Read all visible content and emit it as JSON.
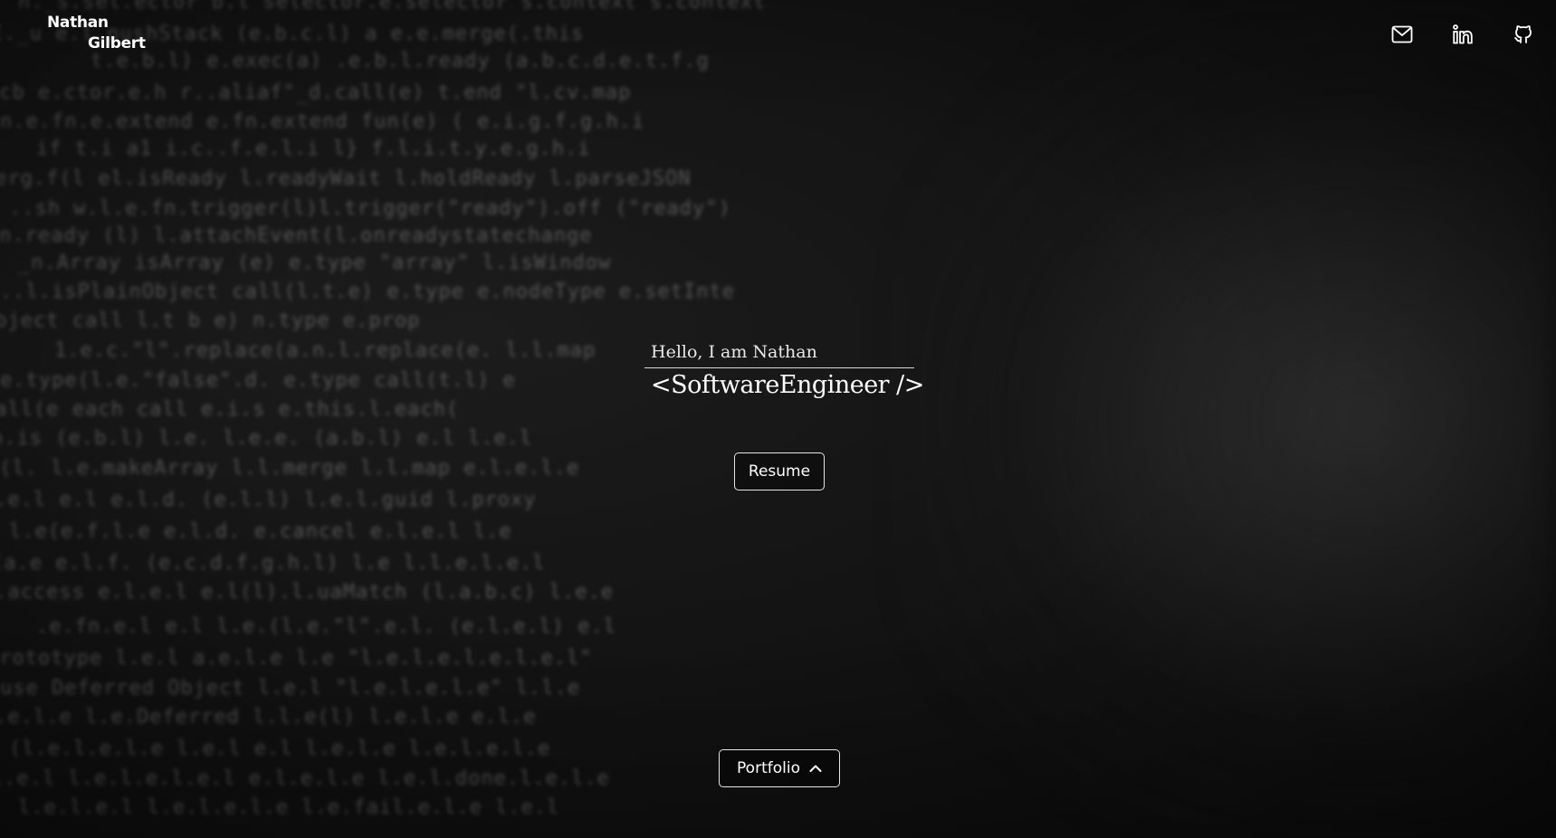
{
  "brand": {
    "first_name": "Nathan",
    "last_name": "Gilbert"
  },
  "social": [
    {
      "name": "mail-icon"
    },
    {
      "name": "linkedin-icon"
    },
    {
      "name": "github-icon"
    }
  ],
  "hero": {
    "greeting": "Hello, I am Nathan",
    "role": "<SoftwareEngineer />"
  },
  "buttons": {
    "resume_label": "Resume",
    "portfolio_label": "Portfolio"
  },
  "icons": {
    "portfolio_chevron": "chevron-up-icon"
  }
}
